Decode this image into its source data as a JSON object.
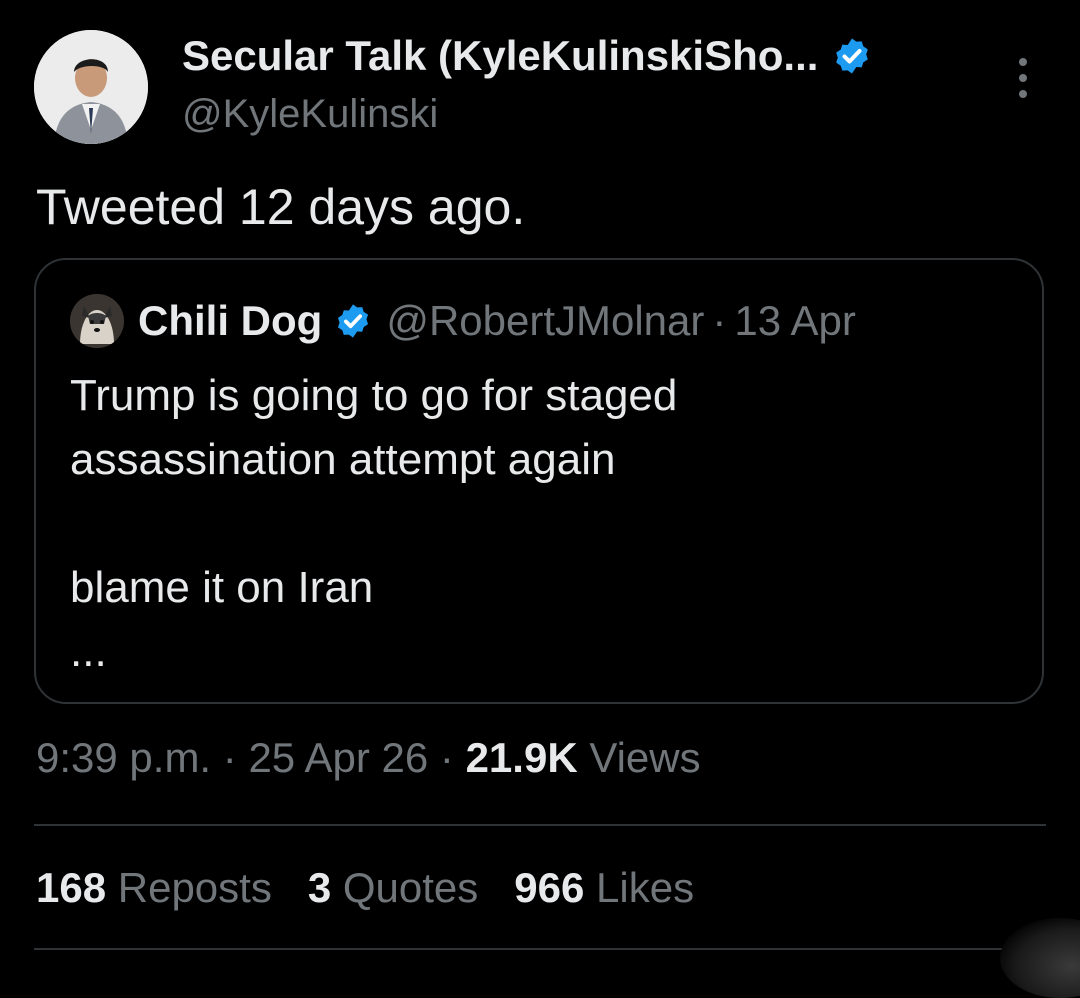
{
  "author": {
    "name": "Secular Talk (KyleKulinskiSho...",
    "handle": "@KyleKulinski",
    "verified_color": "#1d9bf0"
  },
  "tweet": {
    "text": "Tweeted 12 days ago."
  },
  "quoted": {
    "name": "Chili Dog",
    "handle": "@RobertJMolnar",
    "separator": "·",
    "date": "13 Apr",
    "body": "Trump is going to go for staged\nassassination attempt again\n\nblame it on Iran\n..."
  },
  "meta": {
    "time": "9:39 p.m.",
    "sep1": " · ",
    "date": "25 Apr 26",
    "sep2": " · ",
    "views_count": "21.9K",
    "views_label": "Views"
  },
  "stats": {
    "reposts_count": "168",
    "reposts_label": "Reposts",
    "quotes_count": "3",
    "quotes_label": "Quotes",
    "likes_count": "966",
    "likes_label": "Likes"
  },
  "icons": {
    "verified": "verified-badge-icon",
    "more": "more-options-icon"
  }
}
